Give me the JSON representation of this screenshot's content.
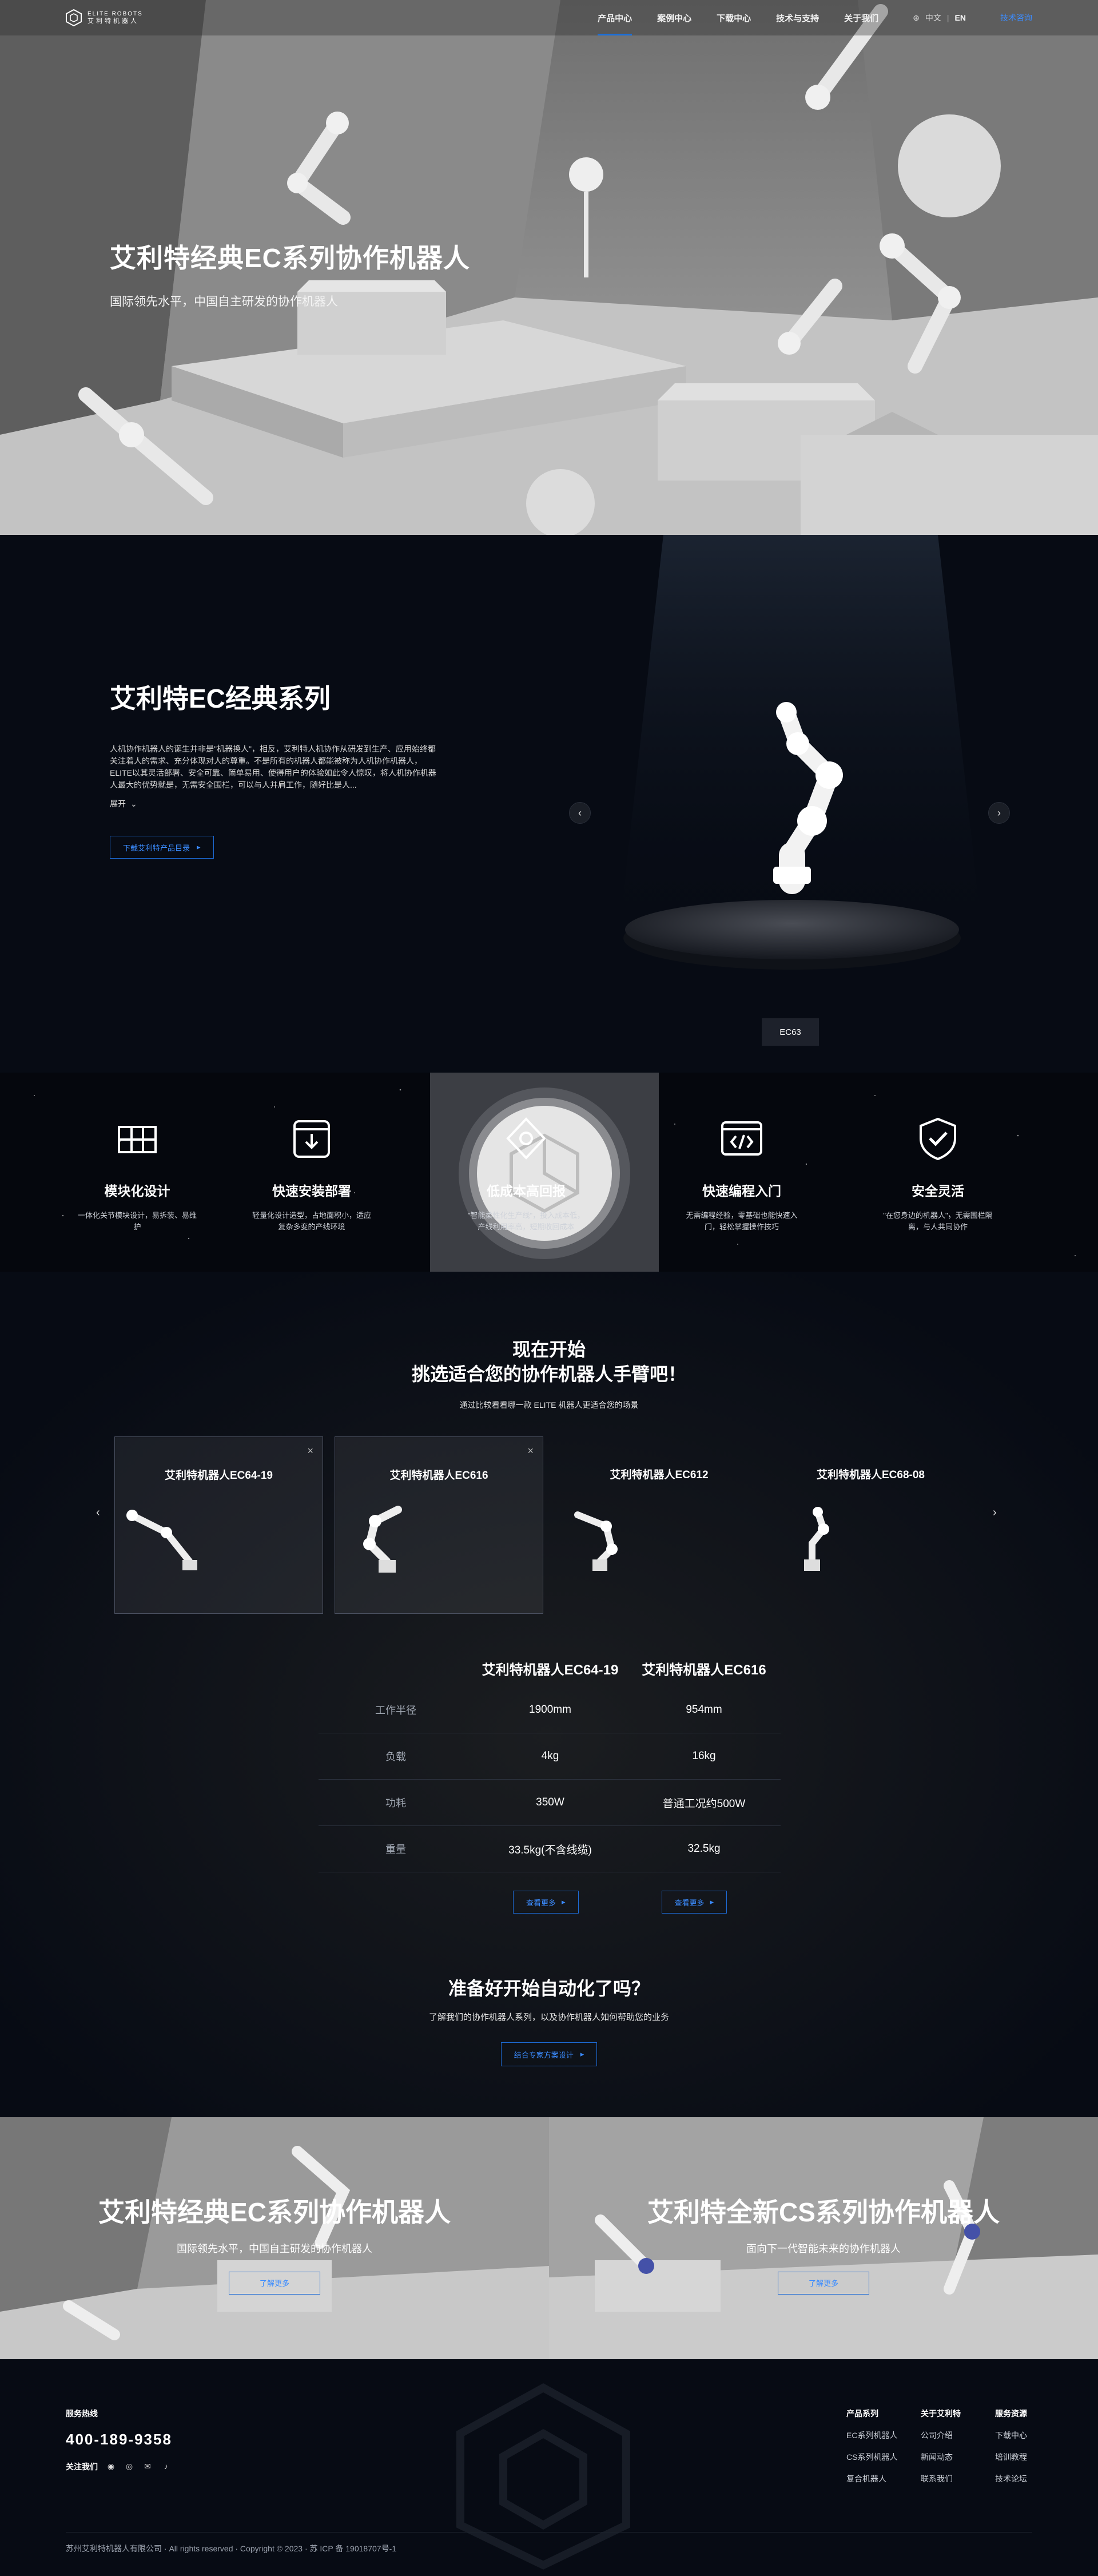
{
  "header": {
    "logo_en": "ELITE ROBOTS",
    "logo_cn": "艾利特机器人",
    "nav": [
      "产品中心",
      "案例中心",
      "下载中心",
      "技术与支持",
      "关于我们"
    ],
    "lang_cn": "中文",
    "lang_sep": "|",
    "lang_en": "EN",
    "tech_link": "技术咨询"
  },
  "hero": {
    "title": "艾利特经典EC系列协作机器人",
    "subtitle": "国际领先水平，中国自主研发的协作机器人"
  },
  "series": {
    "title": "艾利特EC经典系列",
    "description": "人机协作机器人的诞生并非是\"机器换人\"，相反，艾利特人机协作从研发到生产、应用始终都关注着人的需求、充分体现对人的尊重。不是所有的机器人都能被称为人机协作机器人，ELITE以其灵活部署、安全可靠、简单易用、使得用户的体验如此令人惊叹，将人机协作机器人最大的优势就是，无需安全围栏，可以与人并肩工作，随好比是人...",
    "expand": "展开",
    "download": "下载艾利特产品目录",
    "model": "EC63"
  },
  "features": [
    {
      "title": "模块化设计",
      "desc": "一体化关节模块设计，易拆装、易维护"
    },
    {
      "title": "快速安装部署",
      "desc": "轻量化设计造型，占地面积小，适应复杂多变的产线环境"
    },
    {
      "title": "低成本高回报",
      "desc": "\"智能柔性化生产线\"，投入成本低，产线利用率高，短期收回成本"
    },
    {
      "title": "快速编程入门",
      "desc": "无需编程经验，零基础也能快速入门，轻松掌握操作技巧"
    },
    {
      "title": "安全灵活",
      "desc": "\"在您身边的机器人\"，无需围栏隔离，与人共同协作"
    }
  ],
  "compare": {
    "title_line1": "现在开始",
    "title_line2": "挑选适合您的协作机器人手臂吧！",
    "subtitle": "通过比较看看哪一款 ELITE 机器人更适合您的场景",
    "cards": [
      {
        "name": "艾利特机器人EC64-19",
        "close": "×"
      },
      {
        "name": "艾利特机器人EC616",
        "close": "×"
      },
      {
        "name": "艾利特机器人EC612",
        "close": ""
      },
      {
        "name": "艾利特机器人EC68-08",
        "close": ""
      }
    ],
    "table": {
      "headers": [
        "",
        "艾利特机器人EC64-19",
        "艾利特机器人EC616"
      ],
      "rows": [
        [
          "工作半径",
          "1900mm",
          "954mm"
        ],
        [
          "负载",
          "4kg",
          "16kg"
        ],
        [
          "功耗",
          "350W",
          "普通工况约500W"
        ],
        [
          "重量",
          "33.5kg(不含线缆)",
          "32.5kg"
        ]
      ],
      "more": "查看更多"
    }
  },
  "ready": {
    "title": "准备好开始自动化了吗？",
    "subtitle": "了解我们的协作机器人系列，以及协作机器人如何帮助您的业务",
    "button": "结合专家方案设计"
  },
  "banners": [
    {
      "title": "艾利特经典EC系列协作机器人",
      "subtitle": "国际领先水平，中国自主研发的协作机器人",
      "button": "了解更多"
    },
    {
      "title": "艾利特全新CS系列协作机器人",
      "subtitle": "面向下一代智能未来的协作机器人",
      "button": "了解更多"
    }
  ],
  "footer": {
    "hotline_label": "服务热线",
    "hotline": "400-189-9358",
    "follow": "关注我们",
    "columns": [
      {
        "head": "产品系列",
        "items": [
          "EC系列机器人",
          "CS系列机器人",
          "复合机器人"
        ]
      },
      {
        "head": "关于艾利特",
        "items": [
          "公司介绍",
          "新闻动态",
          "联系我们"
        ]
      },
      {
        "head": "服务资源",
        "items": [
          "下载中心",
          "培训教程",
          "技术论坛"
        ]
      }
    ],
    "copyright": "苏州艾利特机器人有限公司 · All rights reserved · Copyright © 2023 · 苏 ICP 备 19018707号-1"
  }
}
